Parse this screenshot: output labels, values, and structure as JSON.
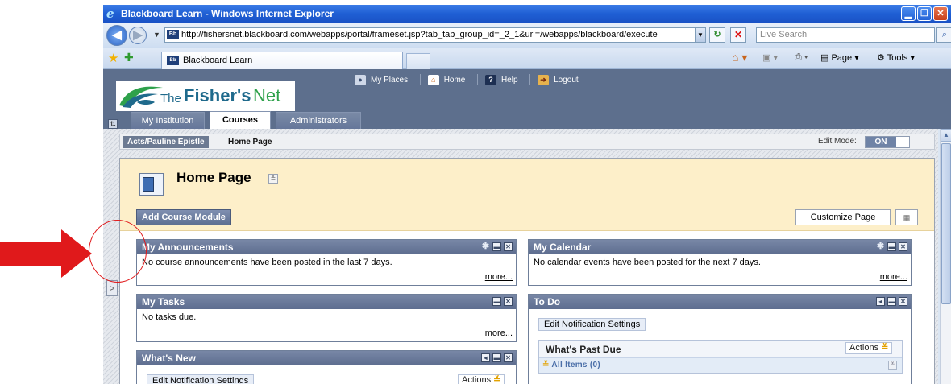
{
  "window": {
    "title": "Blackboard Learn - Windows Internet Explorer",
    "url": "http://fishersnet.blackboard.com/webapps/portal/frameset.jsp?tab_tab_group_id=_2_1&url=/webapps/blackboard/execute",
    "search_placeholder": "Live Search",
    "tab_title": "Blackboard Learn",
    "favicon_text": "Bb",
    "commands": {
      "page": "Page",
      "tools": "Tools"
    }
  },
  "header": {
    "logo": {
      "the": "The",
      "fishers": "Fisher's",
      "net": "Net"
    },
    "top_links": [
      "My Places",
      "Home",
      "Help",
      "Logout"
    ],
    "tabs": [
      "My Institution",
      "Courses",
      "Administrators"
    ],
    "active_tab": "Courses"
  },
  "breadcrumb": {
    "course": "Acts/Pauline Epistle",
    "page": "Home Page",
    "edit_mode_label": "Edit Mode:",
    "edit_mode_value": "ON"
  },
  "page": {
    "title": "Home Page",
    "add_module_label": "Add Course Module",
    "customize_label": "Customize Page"
  },
  "modules": {
    "announcements": {
      "title": "My Announcements",
      "message": "No course announcements have been posted in the last 7 days.",
      "more": "more..."
    },
    "calendar": {
      "title": "My Calendar",
      "message": "No calendar events have been posted for the next 7 days.",
      "more": "more..."
    },
    "tasks": {
      "title": "My Tasks",
      "message": "No tasks due.",
      "more": "more..."
    },
    "todo": {
      "title": "To Do",
      "notification_label": "Edit Notification Settings",
      "past_due_title": "What's Past Due",
      "actions_label": "Actions",
      "all_items_label": "All Items (0)"
    },
    "whats_new": {
      "title": "What's New",
      "notification_label": "Edit Notification Settings",
      "actions_label": "Actions"
    }
  },
  "colors": {
    "annotation_red": "#e0191b",
    "header_bg": "#5d6f8d",
    "page_header_bg": "#fdefc9",
    "module_header": "#6a7a9b"
  }
}
